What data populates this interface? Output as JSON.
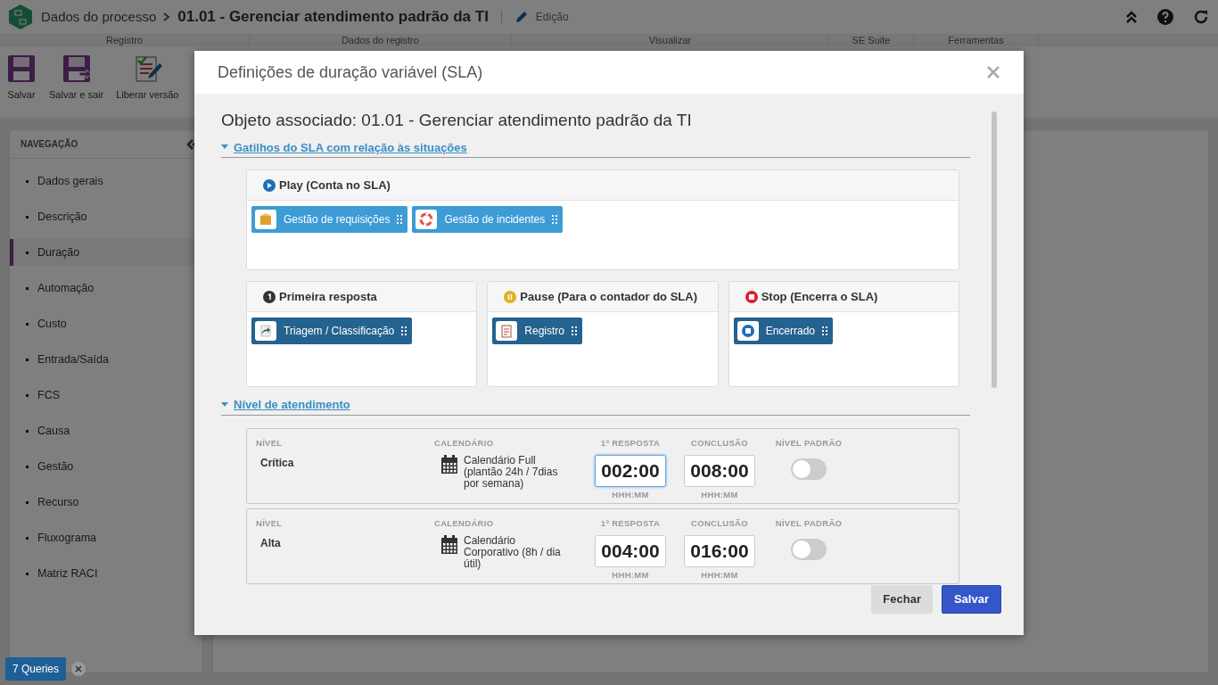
{
  "header": {
    "breadcrumb": "Dados do processo",
    "title": "01.01 - Gerenciar atendimento padrão da TI",
    "mode": "Edição"
  },
  "ribbon": {
    "groups": [
      "Registro",
      "Dados do registro",
      "Visualizar",
      "SE Suite",
      "Ferramentas"
    ],
    "buttons": [
      {
        "kind": "save",
        "label": "Salvar"
      },
      {
        "kind": "save_exit",
        "label": "Salvar e sair"
      },
      {
        "kind": "release",
        "label": "Liberar versão"
      }
    ]
  },
  "navigation": {
    "title": "NAVEGAÇÃO",
    "items": [
      {
        "label": "Dados gerais",
        "selected": false
      },
      {
        "label": "Descrição",
        "selected": false
      },
      {
        "label": "Duração",
        "selected": true
      },
      {
        "label": "Automação",
        "selected": false
      },
      {
        "label": "Custo",
        "selected": false
      },
      {
        "label": "Entrada/Saída",
        "selected": false
      },
      {
        "label": "FCS",
        "selected": false
      },
      {
        "label": "Causa",
        "selected": false
      },
      {
        "label": "Gestão",
        "selected": false
      },
      {
        "label": "Recurso",
        "selected": false
      },
      {
        "label": "Fluxograma",
        "selected": false
      },
      {
        "label": "Matriz RACI",
        "selected": false
      }
    ]
  },
  "queries_badge": {
    "label": "7 Queries"
  },
  "dialog": {
    "title": "Definições de duração variável (SLA)",
    "object": "Objeto associado: 01.01 - Gerenciar atendimento padrão da TI",
    "triggers_section": {
      "title": "Gatilhos do SLA com relação às situações",
      "expanded": true
    },
    "triggers": [
      {
        "kind": "play",
        "title": "Play (Conta no SLA)",
        "items": [
          {
            "kind": "box",
            "label": "Gestão de requisições"
          },
          {
            "kind": "lifebuoy",
            "label": "Gestão de incidentes"
          }
        ]
      },
      {
        "kind": "first",
        "title": "Primeira resposta",
        "items": [
          {
            "kind": "arrow",
            "label": "Triagem / Classificação"
          }
        ]
      },
      {
        "kind": "pause",
        "title": "Pause (Para o contador do SLA)",
        "items": [
          {
            "kind": "form",
            "label": "Registro"
          }
        ]
      },
      {
        "kind": "stop",
        "title": "Stop (Encerra o SLA)",
        "items": [
          {
            "kind": "stop",
            "label": "Encerrado"
          }
        ]
      }
    ],
    "levels_section": {
      "title": "Nível de atendimento",
      "expanded": true
    },
    "levels": [
      {
        "level_label": "NÍVEL",
        "name": "Crítica",
        "calendar_label": "CALENDÁRIO",
        "calendar": "Calendário Full (plantão 24h / 7dias por semana)",
        "first_response_label": "1ª RESPOSTA",
        "first_response": "002:00",
        "first_response_hint": "HHH:MM",
        "first_response_focused": true,
        "conclusion_label": "CONCLUSÃO",
        "conclusion": "008:00",
        "conclusion_hint": "HHH:MM",
        "default_label": "NÍVEL PADRÃO",
        "default": false
      },
      {
        "level_label": "NÍVEL",
        "name": "Alta",
        "calendar_label": "CALENDÁRIO",
        "calendar": "Calendário Corporativo (8h / dia útil)",
        "first_response_label": "1ª RESPOSTA",
        "first_response": "004:00",
        "first_response_hint": "HHH:MM",
        "first_response_focused": false,
        "conclusion_label": "CONCLUSÃO",
        "conclusion": "016:00",
        "conclusion_hint": "HHH:MM",
        "default_label": "NÍVEL PADRÃO",
        "default": false
      }
    ],
    "buttons": [
      {
        "kind": "secondary",
        "label": "Fechar"
      },
      {
        "kind": "primary",
        "label": "Salvar"
      }
    ]
  }
}
